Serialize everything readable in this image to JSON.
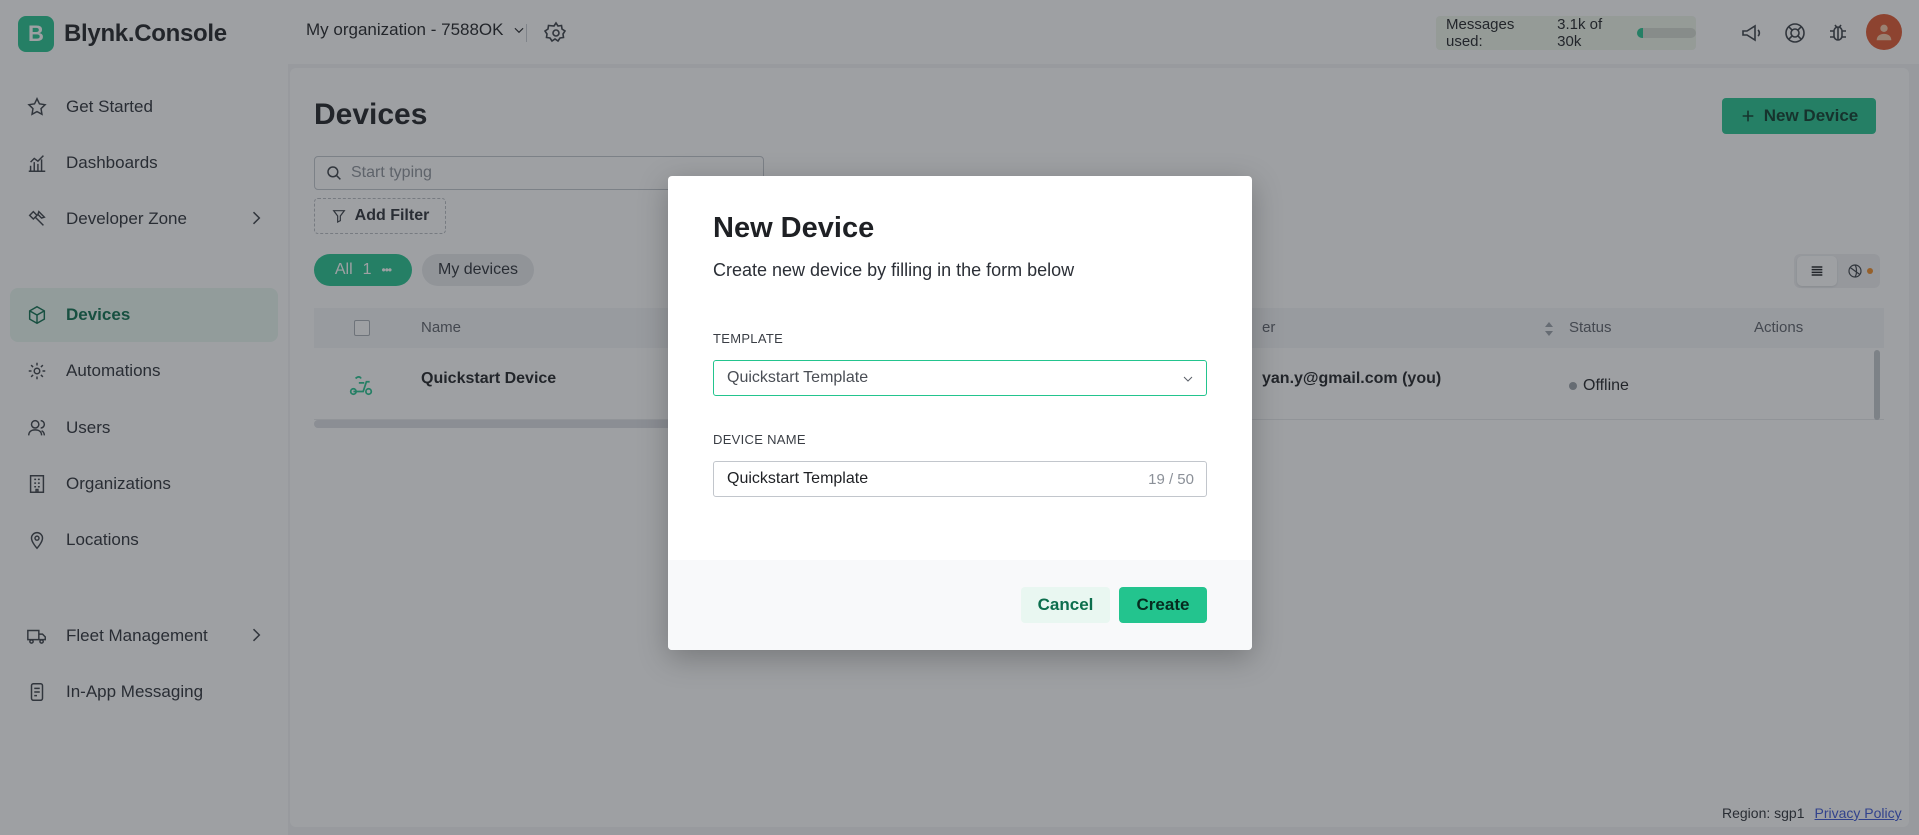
{
  "brand": {
    "logo_letter": "B",
    "name": "Blynk.Console"
  },
  "sidebar": {
    "items": [
      {
        "label": "Get Started",
        "icon": "star-icon"
      },
      {
        "label": "Dashboards",
        "icon": "chart-icon"
      },
      {
        "label": "Developer Zone",
        "icon": "tools-icon",
        "has_submenu": true
      },
      {
        "label": "Devices",
        "icon": "cube-icon",
        "active": true
      },
      {
        "label": "Automations",
        "icon": "automation-icon"
      },
      {
        "label": "Users",
        "icon": "users-icon"
      },
      {
        "label": "Organizations",
        "icon": "building-icon"
      },
      {
        "label": "Locations",
        "icon": "pin-icon"
      },
      {
        "label": "Fleet Management",
        "icon": "truck-icon",
        "has_submenu": true
      },
      {
        "label": "In-App Messaging",
        "icon": "messaging-icon"
      }
    ]
  },
  "topbar": {
    "org_name": "My organization - 7588OK",
    "messages_label": "Messages used:",
    "messages_value": "3.1k of 30k",
    "messages_fraction": 0.103
  },
  "main": {
    "title": "Devices",
    "new_device_label": "New Device",
    "search_placeholder": "Start typing",
    "add_filter_label": "Add Filter",
    "filter_all_label": "All",
    "filter_all_count": "1",
    "filter_my_label": "My devices",
    "columns": {
      "name": "Name",
      "owner": "er",
      "status": "Status",
      "actions": "Actions"
    },
    "rows": [
      {
        "name": "Quickstart Device",
        "owner": "yan.y@gmail.com (you)",
        "status": "Offline"
      }
    ]
  },
  "modal": {
    "title": "New Device",
    "subtitle": "Create new device by filling in the form below",
    "template_label": "TEMPLATE",
    "template_value": "Quickstart Template",
    "device_name_label": "DEVICE NAME",
    "device_name_value": "Quickstart Template",
    "device_name_counter": "19 / 50",
    "cancel_label": "Cancel",
    "create_label": "Create"
  },
  "footer": {
    "region": "Region: sgp1",
    "privacy": "Privacy Policy"
  },
  "colors": {
    "accent": "#23c48e",
    "accent_dark": "#0c6e4d",
    "avatar": "#e0562e"
  }
}
